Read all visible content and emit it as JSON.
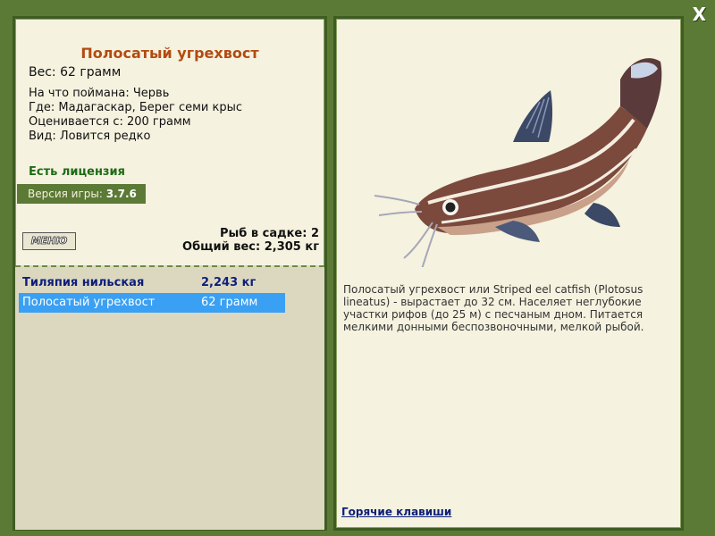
{
  "close_icon_label": "X",
  "fish": {
    "title": "Полосатый угрехвост",
    "weight": "Вес: 62 грамм",
    "bait": "На что поймана: Червь",
    "location": "Где: Мадагаскар, Берег семи крыс",
    "price": "Оценивается с: 200 грамм",
    "rarity": "Вид: Ловится редко"
  },
  "license": "Есть лицензия",
  "version": {
    "label": "Версия игры:",
    "value": "3.7.6"
  },
  "menu_button": "МЕНЮ",
  "cage": {
    "count": "Рыб в садке: 2",
    "total_weight": "Общий вес: 2,305 кг"
  },
  "catch_list": [
    {
      "name": "Тиляпия нильская",
      "weight": "2,243 кг"
    },
    {
      "name": "Полосатый угрехвост",
      "weight": "62 грамм"
    }
  ],
  "description": "Полосатый угрехвост или Striped eel catfish (Plotosus lineatus) - вырастает до 32 см. Населяет неглубокие участки рифов (до 25 м) с песчаным дном. Питается мелкими донными беспозвоночными, мелкой рыбой.",
  "hotkeys_link": "Горячие клавиши",
  "colors": {
    "frame": "#5b7a35",
    "panel": "#f5f2df",
    "title": "#b34a12",
    "license": "#1d6b16",
    "selected_row": "#3aa0f3"
  }
}
